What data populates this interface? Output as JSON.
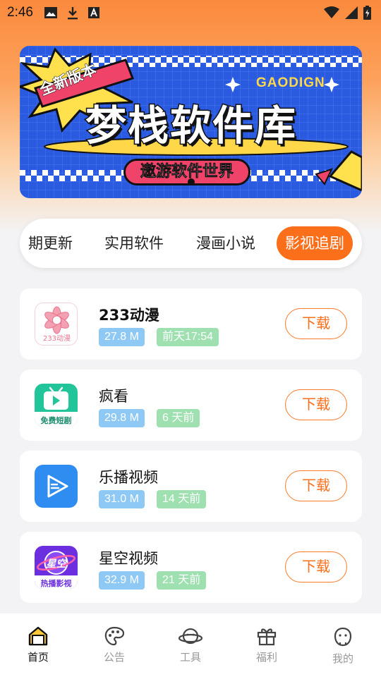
{
  "status_bar": {
    "time": "2:46",
    "left_icons": [
      "image-icon",
      "download-icon",
      "font-icon"
    ],
    "right_icons": [
      "wifi-icon",
      "cell-signal-icon",
      "battery-icon"
    ]
  },
  "banner": {
    "badge": "全新版本",
    "brand": "GAODIGN",
    "title": "梦栈软件库",
    "subtitle": "遨游软件世界",
    "background_color": "#2a5ae0"
  },
  "tabs": [
    {
      "label": "期更新",
      "active": false
    },
    {
      "label": "实用软件",
      "active": false
    },
    {
      "label": "漫画小说",
      "active": false
    },
    {
      "label": "影视追剧",
      "active": true
    }
  ],
  "apps": [
    {
      "name": "233动漫",
      "size": "27.8 M",
      "updated": "前天17:54",
      "download_label": "下载",
      "icon": "233-anime-icon",
      "icon_text": "233动漫"
    },
    {
      "name": "疯看",
      "size": "29.8 M",
      "updated": "6 天前",
      "download_label": "下载",
      "icon": "tv-play-icon",
      "icon_text": "免费短剧"
    },
    {
      "name": "乐播视频",
      "size": "31.0 M",
      "updated": "14 天前",
      "download_label": "下载",
      "icon": "lebo-play-icon",
      "icon_text": ""
    },
    {
      "name": "星空视频",
      "size": "32.9 M",
      "updated": "21 天前",
      "download_label": "下载",
      "icon": "xingkong-icon",
      "icon_text": "热播影视",
      "icon_title": "星空"
    }
  ],
  "bottom_nav": [
    {
      "label": "首页",
      "icon": "home-icon",
      "active": true
    },
    {
      "label": "公告",
      "icon": "palette-icon",
      "active": false
    },
    {
      "label": "工具",
      "icon": "planet-icon",
      "active": false
    },
    {
      "label": "福利",
      "icon": "gift-icon",
      "active": false
    },
    {
      "label": "我的",
      "icon": "face-icon",
      "active": false
    }
  ],
  "colors": {
    "accent": "#fb6f1b",
    "size_tag": "#8ec9f5",
    "time_tag": "#9ee0b0"
  }
}
